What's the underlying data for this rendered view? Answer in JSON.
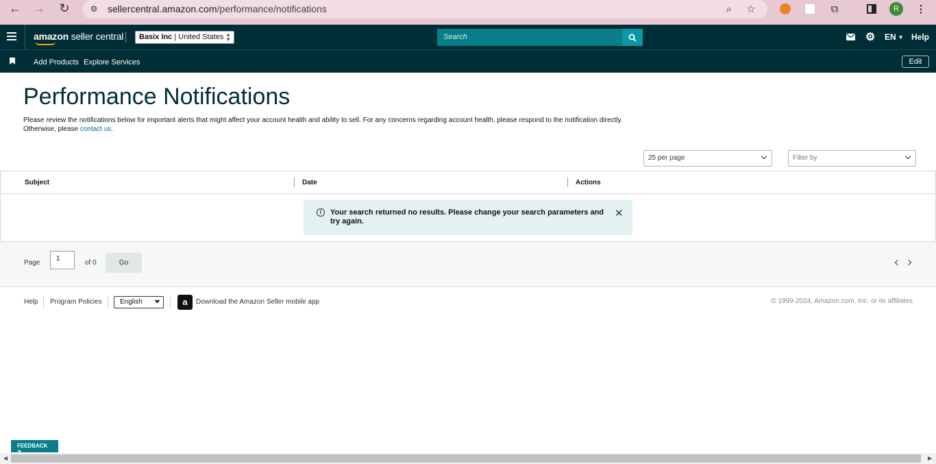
{
  "browser": {
    "url_host": "sellercentral.amazon.com",
    "url_path": "/performance/notifications",
    "profile_initial": "R"
  },
  "header": {
    "logo_amazon": "amazon",
    "logo_rest": "seller central",
    "account": "Basix Inc",
    "marketplace": "United States",
    "search_placeholder": "Search",
    "language": "EN",
    "help": "Help"
  },
  "subnav": {
    "items": [
      "Add Products",
      "Explore Services"
    ],
    "edit": "Edit"
  },
  "page": {
    "title": "Performance Notifications",
    "description_line1": "Please review the notifications below for important alerts that might affect your account health and ability to sell. For any concerns regarding account health, please respond to the notification directly.",
    "description_line2_prefix": "Otherwise, please ",
    "contact_link": "contact us.",
    "per_page": "25 per page",
    "filter_placeholder": "Filter by"
  },
  "table": {
    "columns": [
      "Subject",
      "Date",
      "Actions"
    ],
    "empty_message": "Your search returned no results. Please change your search parameters and try again."
  },
  "pager": {
    "page_label": "Page",
    "current_page": "1",
    "of_label": "of 0",
    "go": "Go"
  },
  "footer": {
    "help": "Help",
    "program_policies": "Program Policies",
    "language": "English",
    "app_text": "Download the Amazon Seller mobile app",
    "copyright": "© 1999-2024, Amazon.com, Inc. or its affiliates"
  },
  "feedback": "FEEDBACK"
}
